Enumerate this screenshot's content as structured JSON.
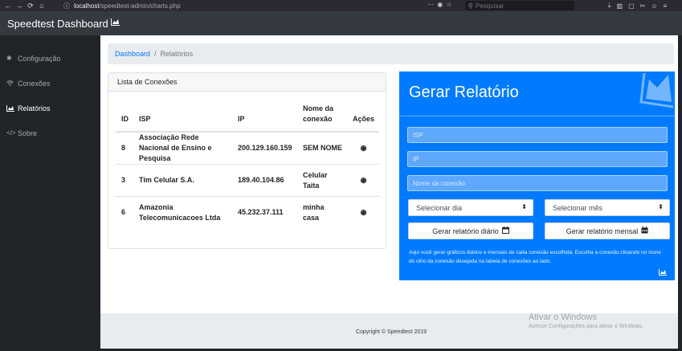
{
  "browser": {
    "url_host": "localhost",
    "url_path": "/speedtest-admin/charts.php",
    "search_placeholder": "Pesquisar"
  },
  "navbar": {
    "brand": "Speedtest Dashboard"
  },
  "sidebar": {
    "items": [
      {
        "label": "Configuração",
        "icon": "gear-icon"
      },
      {
        "label": "Conexões",
        "icon": "wifi-icon"
      },
      {
        "label": "Relatórios",
        "icon": "chart-area-icon",
        "active": true
      },
      {
        "label": "Sobre",
        "icon": "code-icon"
      }
    ]
  },
  "breadcrumb": {
    "home": "Dashboard",
    "separator": "/",
    "current": "Relatórios"
  },
  "connections": {
    "title": "Lista de Conexões",
    "columns": [
      "ID",
      "ISP",
      "IP",
      "Nome da conexão",
      "Ações"
    ],
    "rows": [
      {
        "id": "8",
        "isp": "Associação Rede Nacional de Ensino e Pesquisa",
        "ip": "200.129.160.159",
        "name": "SEM NOME",
        "action_icon": "eye-icon"
      },
      {
        "id": "3",
        "isp": "Tim Celular S.A.",
        "ip": "189.40.104.86",
        "name": "Celular Taita",
        "action_icon": "eye-icon"
      },
      {
        "id": "6",
        "isp": "Amazonia Telecomunicacoes Ltda",
        "ip": "45.232.37.111",
        "name": "minha casa",
        "action_icon": "eye-icon"
      }
    ]
  },
  "report": {
    "title": "Gerar Relatório",
    "isp_placeholder": "ISP",
    "ip_placeholder": "IP",
    "name_placeholder": "Nome da conexão",
    "day_select": "Selecionar dia",
    "month_select": "Selecionar mês",
    "daily_button": "Gerar relatório diário",
    "monthly_button": "Gerar relatório mensal",
    "help_text": "Aqui você gerar gráficos diários e mensais de cada conexão escolhida. Escolha a conexão clicando no ícone do olho da conexão desejada na tabela de conexões ao lado.",
    "accent_color": "#007bff"
  },
  "footer": {
    "copyright": "Copyright © Speedtest 2019"
  },
  "watermark": {
    "title": "Ativar o Windows",
    "subtitle": "Acesse Configurações para ativar o Windows."
  }
}
